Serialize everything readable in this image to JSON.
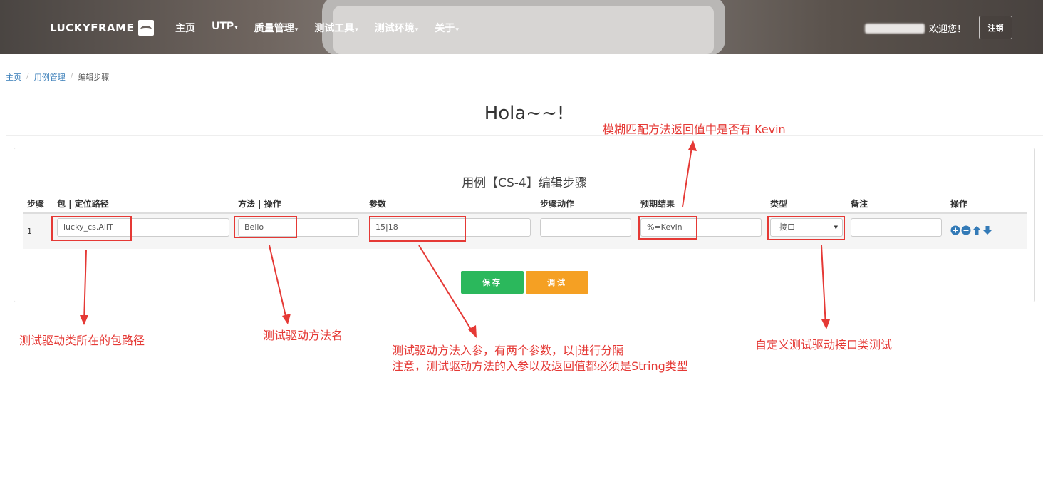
{
  "nav": {
    "logo": "LUCKYFRAME",
    "items": [
      {
        "label": "主页",
        "dropdown": false
      },
      {
        "label": "UTP",
        "dropdown": true
      },
      {
        "label": "质量管理",
        "dropdown": true
      },
      {
        "label": "测试工具",
        "dropdown": true
      },
      {
        "label": "测试环境",
        "dropdown": true
      },
      {
        "label": "关于",
        "dropdown": true
      }
    ],
    "welcome": "欢迎您！",
    "logout": "注销"
  },
  "breadcrumb": {
    "home": "主页",
    "cases": "用例管理",
    "current": "编辑步骤"
  },
  "page_title": "Hola~~!",
  "panel_title": "用例【CS-4】编辑步骤",
  "table": {
    "headers": {
      "step": "步骤",
      "package": "包 | 定位路径",
      "method": "方法 | 操作",
      "params": "参数",
      "action": "步骤动作",
      "expected": "预期结果",
      "type": "类型",
      "remark": "备注",
      "ops": "操作"
    },
    "row": {
      "step": "1",
      "package": "lucky_cs.AliT",
      "method": "Bello",
      "params": "15|18",
      "action": "",
      "expected": "%=Kevin",
      "type": "接口",
      "remark": ""
    }
  },
  "buttons": {
    "save": "保存",
    "debug": "调试"
  },
  "annotations": {
    "expected": "模糊匹配方法返回值中是否有 Kevin",
    "package": "测试驱动类所在的包路径",
    "method": "测试驱动方法名",
    "params_line1": "测试驱动方法入参，有两个参数，以|进行分隔",
    "params_line2": "注意，测试驱动方法的入参以及返回值都必须是String类型",
    "type": "自定义测试驱动接口类测试"
  },
  "colors": {
    "annotation": "#e53935",
    "save": "#2bb85c",
    "debug": "#f5a023",
    "link": "#337ab7",
    "op_icon": "#337ab7"
  },
  "icons": [
    "plus-circle-icon",
    "minus-circle-icon",
    "arrow-up-icon",
    "arrow-down-icon"
  ]
}
